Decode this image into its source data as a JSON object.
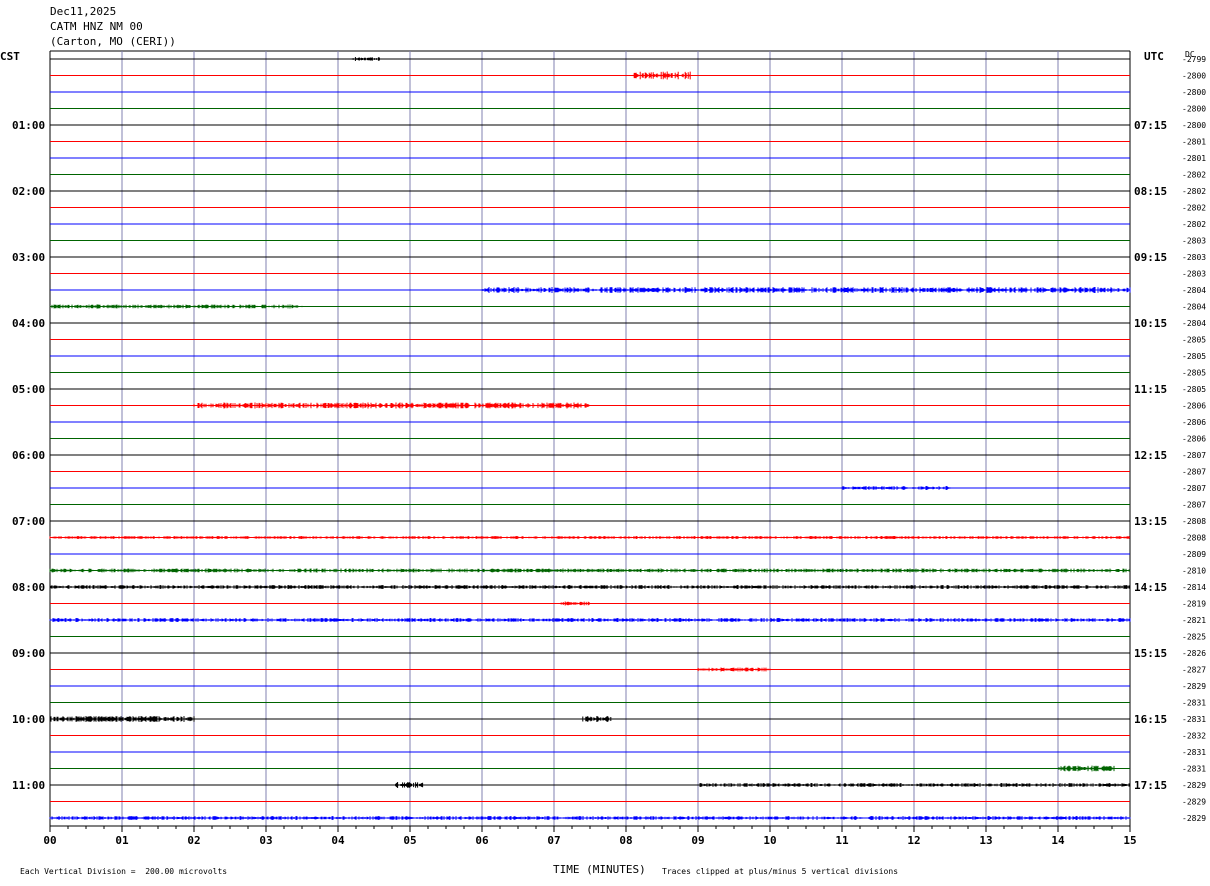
{
  "header": {
    "date": "Dec11,2025",
    "station": "CATM HNZ NM 00",
    "location": "(Carton, MO (CERI))"
  },
  "left_timezone": "CST",
  "right_timezone": "UTC",
  "dc_label": "DC",
  "footer": {
    "scale_note": "Each Vertical Division =  200.00 microvolts",
    "x_axis_title": "TIME (MINUTES)",
    "clip_note": "Traces clipped at plus/minus 5 vertical divisions"
  },
  "colors": {
    "black": "#000000",
    "red": "#ff0000",
    "blue": "#0000ff",
    "green": "#006400",
    "grid": "#8080b0"
  },
  "chart_data": {
    "type": "line",
    "title": "CATM HNZ NM 00",
    "xlabel": "TIME (MINUTES)",
    "xlim": [
      0,
      15
    ],
    "x_ticks": [
      "00",
      "01",
      "02",
      "03",
      "04",
      "05",
      "06",
      "07",
      "08",
      "09",
      "10",
      "11",
      "12",
      "13",
      "14",
      "15"
    ],
    "left_hour_labels": [
      "01:00",
      "02:00",
      "03:00",
      "04:00",
      "05:00",
      "06:00",
      "07:00",
      "08:00",
      "09:00",
      "10:00",
      "11:00"
    ],
    "right_hour_labels": [
      "07:15",
      "08:15",
      "09:15",
      "10:15",
      "11:15",
      "12:15",
      "13:15",
      "14:15",
      "15:15",
      "16:15",
      "17:15"
    ],
    "trace_color_cycle": [
      "black",
      "red",
      "blue",
      "green"
    ],
    "dc_offsets": [
      "-2799",
      "-2800",
      "-2800",
      "-2800",
      "-2800",
      "-2801",
      "-2801",
      "-2802",
      "-2802",
      "-2802",
      "-2802",
      "-2803",
      "-2803",
      "-2803",
      "-2804",
      "-2804",
      "-2804",
      "-2805",
      "-2805",
      "-2805",
      "-2805",
      "-2806",
      "-2806",
      "-2806",
      "-2807",
      "-2807",
      "-2807",
      "-2807",
      "-2808",
      "-2808",
      "-2809",
      "-2810",
      "-2814",
      "-2819",
      "-2821",
      "-2825",
      "-2826",
      "-2827",
      "-2829",
      "-2831",
      "-2831",
      "-2832",
      "-2831",
      "-2831",
      "-2829",
      "-2829",
      "-2829"
    ],
    "activity": [
      {
        "trace": 0,
        "start": 4.2,
        "end": 4.6,
        "amp": 2
      },
      {
        "trace": 1,
        "start": 8.1,
        "end": 8.9,
        "amp": 4
      },
      {
        "trace": 14,
        "start": 6.0,
        "end": 15.0,
        "amp": 3
      },
      {
        "trace": 15,
        "start": 0.0,
        "end": 3.5,
        "amp": 2
      },
      {
        "trace": 21,
        "start": 2.0,
        "end": 7.5,
        "amp": 3
      },
      {
        "trace": 26,
        "start": 11.0,
        "end": 12.5,
        "amp": 2
      },
      {
        "trace": 29,
        "start": 0.0,
        "end": 15.0,
        "amp": 1.5
      },
      {
        "trace": 31,
        "start": 0.0,
        "end": 15.0,
        "amp": 2
      },
      {
        "trace": 32,
        "start": 0.0,
        "end": 15.0,
        "amp": 2
      },
      {
        "trace": 33,
        "start": 7.1,
        "end": 7.5,
        "amp": 2
      },
      {
        "trace": 34,
        "start": 0.0,
        "end": 15.0,
        "amp": 2
      },
      {
        "trace": 37,
        "start": 9.0,
        "end": 10.0,
        "amp": 2
      },
      {
        "trace": 40,
        "start": 0.0,
        "end": 2.0,
        "amp": 3
      },
      {
        "trace": 40,
        "start": 7.4,
        "end": 7.8,
        "amp": 3
      },
      {
        "trace": 43,
        "start": 14.0,
        "end": 14.8,
        "amp": 3
      },
      {
        "trace": 44,
        "start": 4.8,
        "end": 5.2,
        "amp": 3
      },
      {
        "trace": 44,
        "start": 9.0,
        "end": 15.0,
        "amp": 2
      },
      {
        "trace": 46,
        "start": 0.0,
        "end": 15.0,
        "amp": 2
      }
    ]
  }
}
